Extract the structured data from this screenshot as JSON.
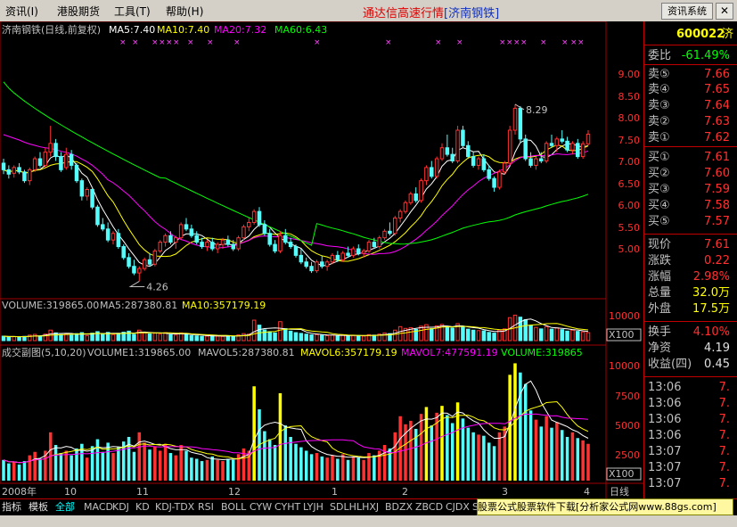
{
  "menu": {
    "items": [
      "资讯(I)",
      "港股期货",
      "工具(T)",
      "帮助(H)"
    ],
    "title_main": "通达信高速行情",
    "title_stock": "[济南钢铁]",
    "news_button": "资讯系统",
    "close_glyph": "✕"
  },
  "main_panel": {
    "stock_title": "济南钢铁(日线,前复权)",
    "ma5": "MA5:7.40",
    "ma10": "MA10:7.40",
    "ma20": "MA20:7.32",
    "ma60": "MA60:6.43",
    "price_ticks": [
      "9.00",
      "8.50",
      "8.00",
      "7.50",
      "7.00",
      "6.50",
      "6.00",
      "5.50",
      "5.00"
    ],
    "high_label": "8.29",
    "low_label": "4.26"
  },
  "volume_panel": {
    "volume": "VOLUME:319865.00",
    "ma5": "MA5:287380.81",
    "ma10": "MA10:357179.19",
    "tick_top": "10000",
    "unit": "X100"
  },
  "turnover_panel": {
    "title": "成交副图(5,10,20)",
    "volume1": "VOLUME1:319865.00",
    "mavol5": "MAVOL5:287380.81",
    "mavol6": "MAVOL6:357179.19",
    "mavol7": "MAVOL7:477591.19",
    "volume": "VOLUME:319865",
    "ticks": [
      "10000",
      "7500",
      "5000",
      "2500"
    ],
    "unit": "X100"
  },
  "x_axis": {
    "labels": [
      "2008年",
      "10",
      "11",
      "12",
      "1",
      "2",
      "3",
      "4"
    ],
    "period": "日线"
  },
  "quote": {
    "code": "600022",
    "code_suffix": "济",
    "rows": [
      {
        "label": "委比",
        "value": "-61.49%"
      },
      {
        "label": "卖⑤",
        "value": "7.66"
      },
      {
        "label": "卖④",
        "value": "7.65"
      },
      {
        "label": "卖③",
        "value": "7.64"
      },
      {
        "label": "卖②",
        "value": "7.63"
      },
      {
        "label": "卖①",
        "value": "7.62"
      },
      {
        "label": "买①",
        "value": "7.61"
      },
      {
        "label": "买②",
        "value": "7.60"
      },
      {
        "label": "买③",
        "value": "7.59"
      },
      {
        "label": "买④",
        "value": "7.58"
      },
      {
        "label": "买⑤",
        "value": "7.57"
      },
      {
        "label": "现价",
        "value": "7.61"
      },
      {
        "label": "涨跌",
        "value": "0.22"
      },
      {
        "label": "涨幅",
        "value": "2.98%"
      },
      {
        "label": "总量",
        "value": "32.0万"
      },
      {
        "label": "外盘",
        "value": "17.5万"
      },
      {
        "label": "换手",
        "value": "4.10%"
      },
      {
        "label": "净资",
        "value": "4.19"
      },
      {
        "label": "收益(四)",
        "value": "0.45"
      },
      {
        "label": "13:06",
        "value": "7."
      },
      {
        "label": "13:06",
        "value": "7."
      },
      {
        "label": "13:06",
        "value": "7."
      },
      {
        "label": "13:06",
        "value": "7."
      },
      {
        "label": "13:07",
        "value": "7."
      },
      {
        "label": "13:07",
        "value": "7."
      },
      {
        "label": "13:07",
        "value": "7."
      },
      {
        "label": "13:07",
        "value": "7."
      }
    ]
  },
  "tabs": [
    "指标",
    "模板",
    "全部",
    "MACD",
    "KDJ",
    "KD",
    "KDJ-TDX",
    "RSI",
    "BOLL",
    "CYW",
    "CYHT",
    "LYJH",
    "SDLH",
    "LHXJ",
    "BDZX",
    "ZBCD",
    "CJDX",
    "SKDJ"
  ],
  "footer_ad": "股票公式股票软件下载[分析家公式网www.88gs.com]",
  "chart_data": {
    "type": "candlestick",
    "title": "济南钢铁(日线,前复权)",
    "period": "日线",
    "y_ticks": [
      5.0,
      5.5,
      6.0,
      6.5,
      7.0,
      7.5,
      8.0,
      8.5,
      9.0
    ],
    "x_labels": [
      "2008年",
      "10",
      "11",
      "12",
      "1",
      "2",
      "3",
      "4"
    ],
    "annotations": {
      "high": 8.29,
      "low": 4.26
    },
    "last_values": {
      "MA5": 7.4,
      "MA10": 7.4,
      "MA20": 7.32,
      "MA60": 6.43
    },
    "ohlc": [
      [
        6.95,
        7.05,
        6.7,
        6.8
      ],
      [
        6.8,
        6.9,
        6.6,
        6.7
      ],
      [
        6.72,
        6.9,
        6.62,
        6.85
      ],
      [
        6.85,
        6.95,
        6.7,
        6.75
      ],
      [
        6.75,
        6.8,
        6.5,
        6.55
      ],
      [
        6.55,
        6.85,
        6.45,
        6.8
      ],
      [
        6.8,
        7.1,
        6.75,
        7.05
      ],
      [
        7.05,
        7.2,
        6.85,
        6.9
      ],
      [
        6.9,
        7.3,
        6.85,
        7.2
      ],
      [
        7.2,
        7.8,
        7.1,
        7.4
      ],
      [
        7.4,
        7.5,
        7.0,
        7.1
      ],
      [
        7.1,
        7.2,
        6.75,
        6.8
      ],
      [
        6.85,
        7.3,
        6.8,
        7.15
      ],
      [
        7.15,
        7.25,
        6.8,
        6.9
      ],
      [
        6.9,
        6.95,
        6.5,
        6.55
      ],
      [
        6.55,
        6.6,
        6.1,
        6.2
      ],
      [
        6.2,
        6.4,
        6.1,
        6.35
      ],
      [
        6.35,
        6.4,
        5.9,
        5.95
      ],
      [
        5.95,
        6.0,
        5.5,
        5.55
      ],
      [
        5.55,
        5.7,
        5.4,
        5.45
      ],
      [
        5.45,
        5.6,
        5.15,
        5.2
      ],
      [
        5.2,
        5.4,
        5.1,
        5.35
      ],
      [
        5.35,
        5.45,
        5.0,
        5.05
      ],
      [
        5.05,
        5.1,
        4.75,
        4.8
      ],
      [
        4.8,
        4.9,
        4.55,
        4.6
      ],
      [
        4.6,
        4.75,
        4.4,
        4.45
      ],
      [
        4.45,
        4.6,
        4.26,
        4.55
      ],
      [
        4.55,
        4.8,
        4.5,
        4.75
      ],
      [
        4.75,
        4.9,
        4.6,
        4.65
      ],
      [
        4.65,
        5.0,
        4.6,
        4.95
      ],
      [
        4.95,
        5.2,
        4.9,
        5.15
      ],
      [
        5.15,
        5.35,
        5.05,
        5.3
      ],
      [
        5.3,
        5.4,
        5.1,
        5.15
      ],
      [
        5.15,
        5.3,
        5.0,
        5.25
      ],
      [
        5.25,
        5.6,
        5.2,
        5.55
      ],
      [
        5.55,
        5.7,
        5.4,
        5.45
      ],
      [
        5.45,
        5.55,
        5.25,
        5.3
      ],
      [
        5.3,
        5.4,
        5.1,
        5.15
      ],
      [
        5.15,
        5.25,
        5.0,
        5.05
      ],
      [
        5.05,
        5.2,
        4.95,
        5.15
      ],
      [
        5.15,
        5.25,
        4.95,
        5.0
      ],
      [
        5.0,
        5.15,
        4.9,
        5.1
      ],
      [
        5.1,
        5.25,
        5.0,
        5.2
      ],
      [
        5.2,
        5.3,
        5.05,
        5.1
      ],
      [
        5.1,
        5.2,
        4.95,
        5.0
      ],
      [
        5.0,
        5.3,
        4.95,
        5.25
      ],
      [
        5.25,
        5.55,
        5.2,
        5.5
      ],
      [
        5.5,
        5.7,
        5.4,
        5.6
      ],
      [
        5.6,
        5.9,
        5.55,
        5.85
      ],
      [
        5.85,
        5.95,
        5.5,
        5.55
      ],
      [
        5.55,
        5.65,
        5.3,
        5.35
      ],
      [
        5.35,
        5.45,
        5.05,
        5.1
      ],
      [
        5.1,
        5.2,
        4.9,
        4.95
      ],
      [
        4.95,
        5.4,
        4.9,
        5.3
      ],
      [
        5.3,
        5.45,
        5.1,
        5.15
      ],
      [
        5.15,
        5.25,
        5.0,
        5.05
      ],
      [
        5.05,
        5.1,
        4.8,
        4.85
      ],
      [
        4.85,
        5.0,
        4.65,
        4.7
      ],
      [
        4.7,
        4.8,
        4.55,
        4.6
      ],
      [
        4.6,
        4.7,
        4.45,
        4.5
      ],
      [
        4.5,
        4.75,
        4.45,
        4.7
      ],
      [
        4.7,
        4.85,
        4.55,
        4.6
      ],
      [
        4.6,
        4.75,
        4.5,
        4.7
      ],
      [
        4.7,
        4.9,
        4.65,
        4.85
      ],
      [
        4.85,
        4.95,
        4.7,
        4.75
      ],
      [
        4.75,
        4.95,
        4.7,
        4.9
      ],
      [
        4.9,
        5.05,
        4.8,
        4.85
      ],
      [
        4.85,
        5.05,
        4.8,
        5.0
      ],
      [
        5.0,
        5.1,
        4.85,
        4.9
      ],
      [
        4.9,
        5.0,
        4.8,
        4.95
      ],
      [
        4.95,
        5.2,
        4.9,
        5.15
      ],
      [
        5.15,
        5.25,
        5.0,
        5.05
      ],
      [
        5.05,
        5.3,
        5.0,
        5.25
      ],
      [
        5.25,
        5.45,
        5.2,
        5.4
      ],
      [
        5.4,
        5.6,
        5.3,
        5.35
      ],
      [
        5.35,
        5.75,
        5.3,
        5.7
      ],
      [
        5.7,
        5.9,
        5.6,
        5.85
      ],
      [
        5.85,
        6.1,
        5.8,
        6.05
      ],
      [
        6.05,
        6.3,
        6.0,
        6.25
      ],
      [
        6.25,
        6.4,
        6.05,
        6.1
      ],
      [
        6.1,
        6.6,
        6.05,
        6.55
      ],
      [
        6.55,
        6.9,
        6.45,
        6.85
      ],
      [
        6.85,
        7.0,
        6.6,
        6.65
      ],
      [
        6.65,
        7.1,
        6.6,
        7.05
      ],
      [
        7.05,
        7.4,
        7.0,
        7.3
      ],
      [
        7.3,
        7.6,
        7.1,
        7.15
      ],
      [
        7.15,
        7.3,
        6.95,
        7.0
      ],
      [
        7.0,
        7.8,
        6.95,
        7.7
      ],
      [
        7.7,
        7.8,
        7.3,
        7.35
      ],
      [
        7.35,
        7.45,
        7.05,
        7.1
      ],
      [
        7.1,
        7.2,
        6.85,
        6.9
      ],
      [
        6.9,
        7.1,
        6.8,
        7.05
      ],
      [
        7.05,
        7.15,
        6.75,
        6.8
      ],
      [
        6.8,
        6.9,
        6.55,
        6.6
      ],
      [
        6.6,
        6.65,
        6.3,
        6.4
      ],
      [
        6.4,
        6.8,
        6.35,
        6.75
      ],
      [
        6.75,
        7.0,
        6.7,
        6.95
      ],
      [
        6.95,
        7.8,
        6.9,
        7.7
      ],
      [
        7.7,
        8.29,
        7.6,
        8.2
      ],
      [
        8.2,
        8.25,
        7.4,
        7.5
      ],
      [
        7.5,
        7.6,
        7.0,
        7.05
      ],
      [
        7.05,
        7.2,
        6.85,
        6.9
      ],
      [
        6.9,
        7.1,
        6.8,
        7.05
      ],
      [
        7.05,
        7.2,
        6.95,
        7.0
      ],
      [
        7.0,
        7.45,
        6.95,
        7.4
      ],
      [
        7.4,
        7.6,
        7.3,
        7.35
      ],
      [
        7.35,
        7.55,
        7.2,
        7.5
      ],
      [
        7.5,
        7.7,
        7.4,
        7.45
      ],
      [
        7.45,
        7.55,
        7.2,
        7.25
      ],
      [
        7.25,
        7.45,
        7.15,
        7.4
      ],
      [
        7.4,
        7.5,
        7.05,
        7.1
      ],
      [
        7.1,
        7.45,
        7.05,
        7.39
      ],
      [
        7.39,
        7.7,
        7.35,
        7.61
      ]
    ],
    "volume_x100": [
      1800,
      1500,
      1600,
      1400,
      1700,
      2200,
      2500,
      1900,
      2600,
      4200,
      3100,
      2400,
      2600,
      2200,
      2800,
      3200,
      2000,
      3000,
      3600,
      2500,
      3300,
      2400,
      2900,
      3400,
      3800,
      2500,
      4200,
      3300,
      2700,
      3000,
      2600,
      3200,
      2400,
      2200,
      3100,
      2600,
      2000,
      1900,
      1700,
      1800,
      2100,
      1800,
      1700,
      1900,
      1800,
      2300,
      2800,
      2600,
      8200,
      6200,
      4300,
      3600,
      3100,
      7600,
      4800,
      3800,
      3200,
      2900,
      2600,
      2300,
      2400,
      2100,
      2000,
      2200,
      1900,
      2300,
      1800,
      2100,
      2000,
      1800,
      2400,
      2200,
      2600,
      3100,
      2800,
      4200,
      5600,
      4900,
      5200,
      4500,
      5800,
      6400,
      4800,
      5900,
      6500,
      5700,
      5000,
      6800,
      5400,
      4600,
      4200,
      4000,
      3900,
      3300,
      3000,
      4200,
      4700,
      9200,
      10200,
      9400,
      8400,
      6100,
      5300,
      4700,
      5600,
      4600,
      5100,
      4400,
      3800,
      4200,
      3700,
      3500,
      3198
    ]
  }
}
